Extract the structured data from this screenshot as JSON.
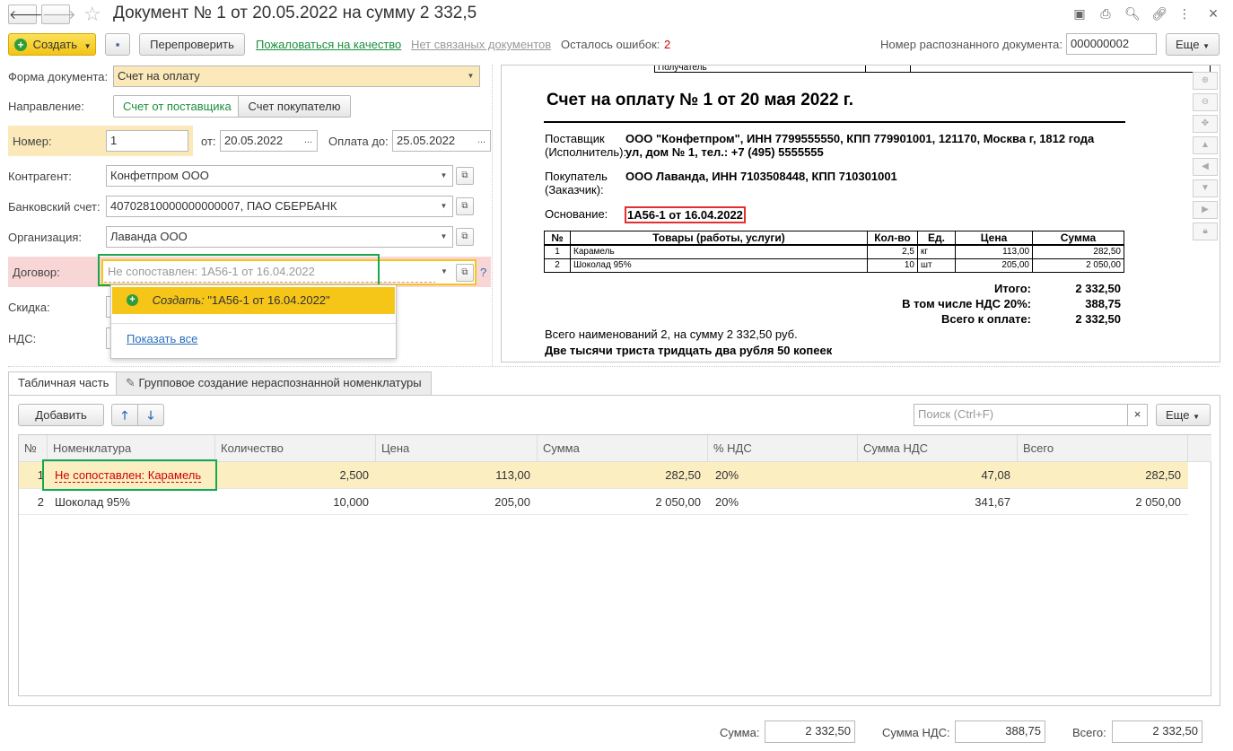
{
  "window": {
    "title": "Документ № 1 от 20.05.2022 на сумму 2 332,5"
  },
  "toolbar": {
    "create_label": "Создать",
    "recheck_label": "Перепроверить",
    "complain_label": "Пожаловаться на качество",
    "no_linked_label": "Нет связаных документов",
    "errors_label": "Осталось ошибок:",
    "errors_count": "2",
    "recognized_num_label": "Номер распознанного документа:",
    "recognized_num_value": "000000002",
    "more_label": "Еще"
  },
  "form": {
    "doc_form_label": "Форма документа:",
    "doc_form_value": "Счет на оплату",
    "direction_label": "Направление:",
    "direction_supplier": "Счет от поставщика",
    "direction_buyer": "Счет покупателю",
    "number_label": "Номер:",
    "number_value": "1",
    "from_label": "от:",
    "from_value": "20.05.2022",
    "pay_until_label": "Оплата до:",
    "pay_until_value": "25.05.2022",
    "counterparty_label": "Контрагент:",
    "counterparty_value": "Конфетпром ООО",
    "bank_label": "Банковский счет:",
    "bank_value": "40702810000000000007, ПАО СБЕРБАНК",
    "org_label": "Организация:",
    "org_value": "Лаванда ООО",
    "contract_label": "Договор:",
    "contract_placeholder": "Не сопоставлен: 1А56-1 от 16.04.2022",
    "contract_help": "?",
    "discount_label": "Скидка:",
    "vat_label": "НДС:"
  },
  "dropdown": {
    "create_prefix": "Создать:",
    "create_value": "\"1А56-1 от 16.04.2022\"",
    "show_all": "Показать все"
  },
  "document": {
    "top_row_text": "Получатель",
    "heading": "Счет на оплату № 1 от 20 мая 2022 г.",
    "supplier_label_1": "Поставщик",
    "supplier_label_2": "(Исполнитель):",
    "supplier_line_1": "ООО \"Конфетпром\", ИНН 7799555550, КПП 779901001, 121170, Москва г, 1812 года",
    "supplier_line_2": "ул, дом № 1, тел.: +7 (495) 5555555",
    "buyer_label_1": "Покупатель",
    "buyer_label_2": "(Заказчик):",
    "buyer_value": "ООО Лаванда, ИНН 7103508448, КПП 710301001",
    "basis_label": "Основание:",
    "basis_value": "1А56-1 от 16.04.2022",
    "table_headers": [
      "№",
      "Товары (работы, услуги)",
      "Кол-во",
      "Ед.",
      "Цена",
      "Сумма"
    ],
    "table_rows": [
      [
        "1",
        "Карамель",
        "2,5",
        "кг",
        "113,00",
        "282,50"
      ],
      [
        "2",
        "Шоколад 95%",
        "10",
        "шт",
        "205,00",
        "2 050,00"
      ]
    ],
    "total_label": "Итого:",
    "total_value": "2 332,50",
    "vat_label": "В том числе НДС 20%:",
    "vat_value": "388,75",
    "to_pay_label": "Всего к оплате:",
    "to_pay_value": "2 332,50",
    "count_line": "Всего наименований 2, на сумму 2 332,50 руб.",
    "words_line": "Две тысячи триста тридцать два рубля 50 копеек"
  },
  "tabs": [
    {
      "label": "Табличная часть"
    },
    {
      "label": "Групповое создание нераспознанной номенклатуры"
    }
  ],
  "grid_toolbar": {
    "add_label": "Добавить",
    "search_placeholder": "Поиск (Ctrl+F)",
    "clear_label": "×",
    "more_label": "Еще"
  },
  "grid": {
    "headers": [
      "№",
      "Номенклатура",
      "Количество",
      "Цена",
      "Сумма",
      "% НДС",
      "Сумма НДС",
      "Всего"
    ],
    "rows": [
      [
        "1",
        "Не сопоставлен: Карамель",
        "2,500",
        "113,00",
        "282,50",
        "20%",
        "47,08",
        "282,50"
      ],
      [
        "2",
        "Шоколад 95%",
        "10,000",
        "205,00",
        "2 050,00",
        "20%",
        "341,67",
        "2 050,00"
      ]
    ]
  },
  "footer": {
    "sum_label": "Сумма:",
    "sum_value": "2 332,50",
    "vat_label": "Сумма НДС:",
    "vat_value": "388,75",
    "total_label": "Всего:",
    "total_value": "2 332,50"
  },
  "colors": {
    "accent_yellow": "#f5c518",
    "link_green": "#1a8f3c",
    "error_red": "#d00000",
    "highlight_box": "#18a84c",
    "row_selected": "#fbefc2"
  }
}
